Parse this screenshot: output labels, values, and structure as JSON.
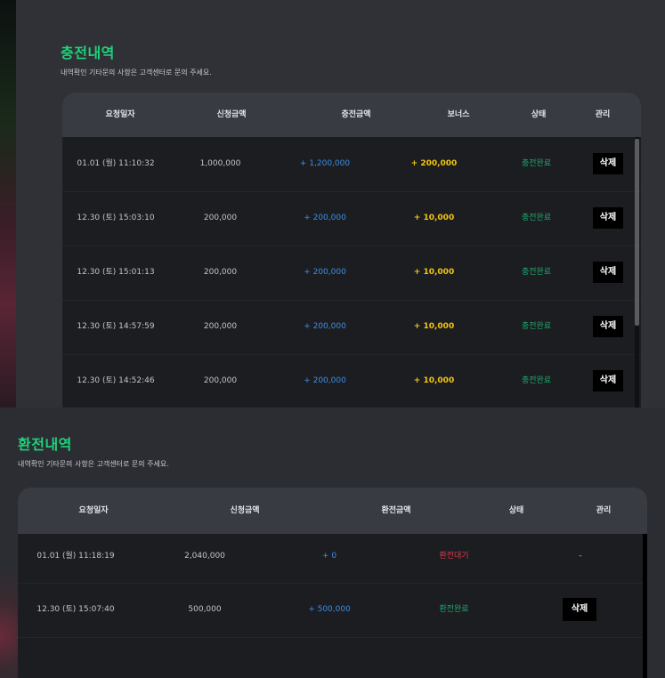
{
  "charge": {
    "title": "충전내역",
    "desc": "내역확인 기타문의 사항은 고객센터로 문의 주세요.",
    "headers": {
      "date": "요청일자",
      "apply": "신청금액",
      "amount": "충전금액",
      "bonus": "보너스",
      "status": "상태",
      "manage": "관리"
    },
    "rows": [
      {
        "date": "01.01 (월) 11:10:32",
        "apply": "1,000,000",
        "amount": "+ 1,200,000",
        "bonus": "+ 200,000",
        "status": "충전완료",
        "action": "삭제"
      },
      {
        "date": "12.30 (토) 15:03:10",
        "apply": "200,000",
        "amount": "+ 200,000",
        "bonus": "+ 10,000",
        "status": "충전완료",
        "action": "삭제"
      },
      {
        "date": "12.30 (토) 15:01:13",
        "apply": "200,000",
        "amount": "+ 200,000",
        "bonus": "+ 10,000",
        "status": "충전완료",
        "action": "삭제"
      },
      {
        "date": "12.30 (토) 14:57:59",
        "apply": "200,000",
        "amount": "+ 200,000",
        "bonus": "+ 10,000",
        "status": "충전완료",
        "action": "삭제"
      },
      {
        "date": "12.30 (토) 14:52:46",
        "apply": "200,000",
        "amount": "+ 200,000",
        "bonus": "+ 10,000",
        "status": "충전완료",
        "action": "삭제"
      }
    ]
  },
  "exchange": {
    "title": "환전내역",
    "desc": "내역확인 기타문의 사항은 고객센터로 문의 주세요.",
    "headers": {
      "date": "요청일자",
      "apply": "신청금액",
      "amount": "환전금액",
      "status": "상태",
      "manage": "관리"
    },
    "rows": [
      {
        "date": "01.01 (월) 11:18:19",
        "apply": "2,040,000",
        "amount": "+ 0",
        "status": "환전대기",
        "action": "-"
      },
      {
        "date": "12.30 (토) 15:07:40",
        "apply": "500,000",
        "amount": "+ 500,000",
        "status": "환전완료",
        "action": "삭제"
      }
    ]
  },
  "colors": {
    "accent": "#1fd17a",
    "blue": "#3b8ee6",
    "yellow": "#f2c511",
    "green": "#1ea86b",
    "red": "#d83c4a"
  }
}
